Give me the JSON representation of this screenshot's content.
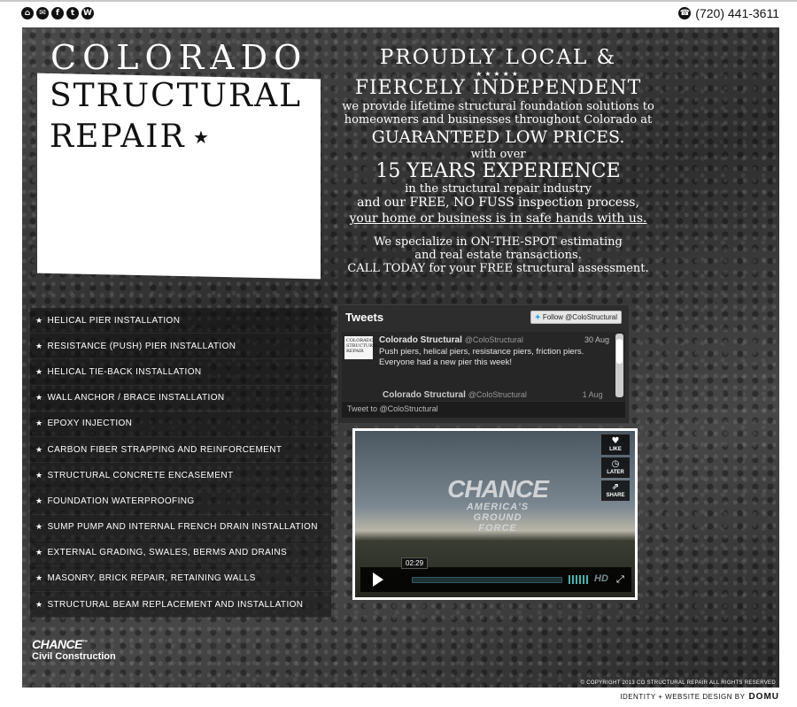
{
  "header": {
    "social_icons": [
      {
        "name": "home-icon",
        "glyph": "⌂"
      },
      {
        "name": "email-icon",
        "glyph": "✉"
      },
      {
        "name": "facebook-icon",
        "glyph": "f"
      },
      {
        "name": "twitter-icon",
        "glyph": "t"
      },
      {
        "name": "wordpress-icon",
        "glyph": "W"
      }
    ],
    "phone_glyph": "☎",
    "phone": "(720) 441-3611"
  },
  "logo": {
    "line_top": "COLORADO",
    "line_1": "STRUCTURAL",
    "line_2": "REPAIR",
    "star": "★"
  },
  "headline": {
    "proud": "PROUDLY LOCAL &",
    "stars": "★★★★★",
    "fierce": "FIERCELY INDEPENDENT",
    "p1": "we provide lifetime structural foundation solutions to homeowners and businesses throughout Colorado at",
    "guaranteed": "GUARANTEED LOW PRICES.",
    "with_over": "with over",
    "years": "15 YEARS EXPERIENCE",
    "industry": "in the structural repair industry",
    "inspection": "and our FREE, NO FUSS inspection process,",
    "safe_hands": "your home or business is in safe hands with us.",
    "spot": "We specialize in ON-THE-SPOT estimating",
    "real_estate": "and real estate transactions.",
    "call_today": "CALL TODAY for your FREE structural assessment."
  },
  "services": [
    "HELICAL PIER INSTALLATION",
    "RESISTANCE (PUSH) PIER INSTALLATION",
    "HELICAL TIE-BACK INSTALLATION",
    "WALL ANCHOR / BRACE INSTALLATION",
    "EPOXY INJECTION",
    "CARBON FIBER STRAPPING AND REINFORCEMENT",
    "STRUCTURAL CONCRETE ENCASEMENT",
    "FOUNDATION WATERPROOFING",
    "SUMP PUMP AND INTERNAL FRENCH DRAIN INSTALLATION",
    "EXTERNAL GRADING, SWALES, BERMS AND DRAINS",
    "MASONRY, BRICK REPAIR, RETAINING WALLS",
    "STRUCTURAL BEAM REPLACEMENT AND INSTALLATION"
  ],
  "service_star": "★",
  "tweets": {
    "title": "Tweets",
    "follow_label": "Follow @ColoStructural",
    "avatar_text": "COLORADO STRUCTURAL REPAIR",
    "tweet": {
      "name": "Colorado Structural",
      "handle": "@ColoStructural",
      "date": "30 Aug",
      "text": "Push piers, helical piers, resistance piers, friction piers. Everyone had a new pier this week!"
    },
    "peek": {
      "name": "Colorado Structural",
      "handle": "@ColoStructural",
      "date": "1 Aug"
    },
    "compose_placeholder": "Tweet to @ColoStructural"
  },
  "video": {
    "logo_main": "CHANCE",
    "logo_sub_1": "AMERICA'S",
    "logo_sub_2": "GROUND",
    "logo_sub_3": "FORCE",
    "like_label": "LIKE",
    "later_label": "LATER",
    "share_label": "SHARE",
    "time": "02:29",
    "hd_label": "HD"
  },
  "chance_logo": {
    "line_1": "CHANCE",
    "tm": "™",
    "line_2": "Civil Construction"
  },
  "copyright": "© COPYRIGHT 2013 CO STRUCTURAL REPAIR ALL RIGHTS RESERVED",
  "credit": {
    "label": "IDENTITY + WEBSITE DESIGN BY",
    "brand": "DOMU"
  }
}
